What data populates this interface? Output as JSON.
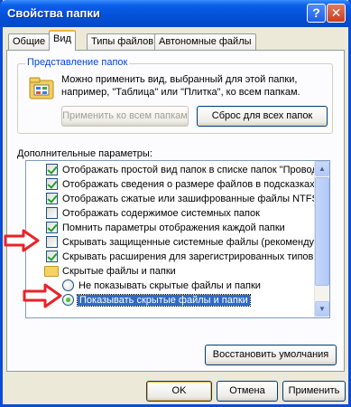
{
  "window": {
    "title": "Свойства папки",
    "help_label": "?",
    "close_label": "✕"
  },
  "tabs": [
    {
      "label": "Общие"
    },
    {
      "label": "Вид"
    },
    {
      "label": "Типы файлов"
    },
    {
      "label": "Автономные файлы"
    }
  ],
  "folder_views": {
    "group_label": "Представление папок",
    "description": "Можно применить вид, выбранный для этой папки, например, \"Таблица\" или \"Плитка\", ко всем папкам.",
    "apply_all_label": "Применить ко всем папкам",
    "reset_all_label": "Сброс для всех папок"
  },
  "advanced": {
    "label": "Дополнительные параметры:",
    "items": [
      {
        "type": "checkbox",
        "checked": true,
        "label": "Отображать простой вид папок в списке папок \"Проводни"
      },
      {
        "type": "checkbox",
        "checked": true,
        "label": "Отображать сведения о размере файлов в подсказках п"
      },
      {
        "type": "checkbox",
        "checked": true,
        "label": "Отображать сжатые или зашифрованные файлы NTFS др"
      },
      {
        "type": "checkbox",
        "checked": false,
        "label": "Отображать содержимое системных папок"
      },
      {
        "type": "checkbox",
        "checked": true,
        "label": "Помнить параметры отображения каждой папки"
      },
      {
        "type": "checkbox",
        "checked": false,
        "label": "Скрывать защищенные системные файлы (рекомендуетс"
      },
      {
        "type": "checkbox",
        "checked": true,
        "label": "Скрывать расширения для зарегистрированных типов ф"
      },
      {
        "type": "folder",
        "label": "Скрытые файлы и папки"
      },
      {
        "type": "radio",
        "checked": false,
        "label": "Не показывать скрытые файлы и папки"
      },
      {
        "type": "radio",
        "checked": true,
        "label": "Показывать скрытые файлы и папки"
      }
    ]
  },
  "restore_defaults_label": "Восстановить умолчания",
  "ok_label": "OK",
  "cancel_label": "Отмена",
  "apply_label": "Применить",
  "colors": {
    "title_blue": "#0450d8",
    "face": "#ece9d8",
    "arrow_red": "#e8232a",
    "selection": "#316ac5"
  }
}
